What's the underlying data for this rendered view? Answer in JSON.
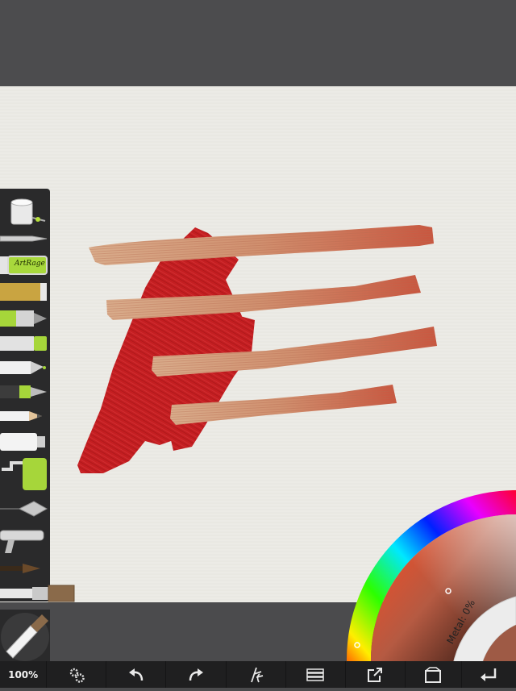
{
  "toolbar": {
    "zoom": "100%",
    "items": [
      "settings",
      "undo",
      "redo",
      "tool-style",
      "layers",
      "share",
      "gallery",
      "back"
    ]
  },
  "tools": [
    "paint-bucket",
    "palette-knife-flat",
    "eraser",
    "glitter-tube",
    "felt-tip-pen",
    "marker",
    "felt-pen-fine",
    "ink-pen",
    "pencil",
    "paint-tube",
    "paint-roller",
    "palette-knife",
    "airbrush",
    "watercolor-brush",
    "oil-brush"
  ],
  "eraser_brand": "ArtRage",
  "color_picker": {
    "metal_label": "Metal: 0%",
    "selected_color": "#9e5a45"
  },
  "colors": {
    "stroke_red": "#c61f22",
    "stroke_tan": "#d6a07f",
    "stroke_tan_edge": "#c9503a",
    "rail": "#2a2a2b",
    "toolbar": "#1f1f20"
  }
}
